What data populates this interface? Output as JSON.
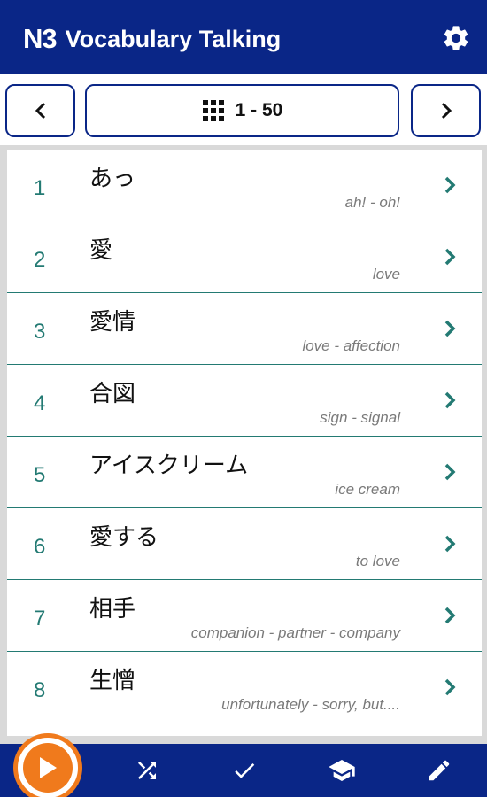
{
  "header": {
    "logo_text": "N3",
    "title": "Vocabulary Talking",
    "settings_icon": "gear-icon"
  },
  "pager": {
    "prev_icon": "chevron-left-icon",
    "range_label": "1 - 50",
    "grid_icon": "grid-icon",
    "next_icon": "chevron-right-icon"
  },
  "vocab": [
    {
      "num": "1",
      "jp": "あっ",
      "en": "ah! - oh!"
    },
    {
      "num": "2",
      "jp": "愛",
      "en": "love"
    },
    {
      "num": "3",
      "jp": "愛情",
      "en": "love - affection"
    },
    {
      "num": "4",
      "jp": "合図",
      "en": "sign - signal"
    },
    {
      "num": "5",
      "jp": "アイスクリーム",
      "en": "ice cream"
    },
    {
      "num": "6",
      "jp": "愛する",
      "en": "to love"
    },
    {
      "num": "7",
      "jp": "相手",
      "en": "companion - partner - company"
    },
    {
      "num": "8",
      "jp": "生憎",
      "en": "unfortunately - sorry, but...."
    }
  ],
  "toolbar": {
    "play_icon": "play-icon",
    "shuffle_icon": "shuffle-icon",
    "check_icon": "check-icon",
    "learn_icon": "graduation-cap-icon",
    "edit_icon": "pencil-icon"
  },
  "colors": {
    "primary": "#0a2687",
    "teal": "#237a73",
    "accent": "#f07a1c"
  }
}
